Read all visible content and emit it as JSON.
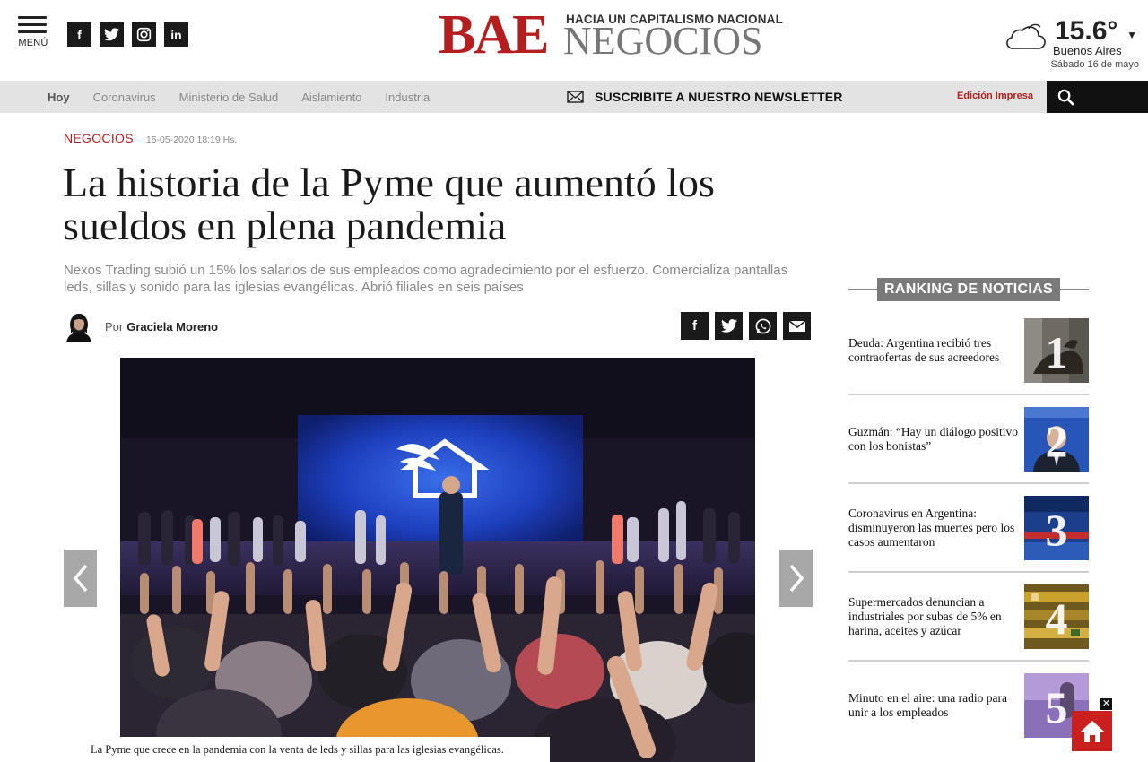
{
  "header": {
    "menu_label": "MENÚ",
    "social": [
      {
        "icon": "facebook-icon",
        "glyph": "f"
      },
      {
        "icon": "twitter-icon",
        "glyph": ""
      },
      {
        "icon": "instagram-icon",
        "glyph": ""
      },
      {
        "icon": "linkedin-icon",
        "glyph": "in"
      }
    ],
    "logo": {
      "main": "BAE",
      "tagline": "HACIA UN CAPITALISMO NACIONAL",
      "sub": "NEGOCIOS"
    },
    "weather": {
      "temp": "15.6°",
      "city": "Buenos Aires",
      "date": "Sábado 16 de mayo"
    }
  },
  "nav": {
    "items": [
      "Hoy",
      "Coronavirus",
      "Ministerio de Salud",
      "Aislamiento",
      "Industria"
    ],
    "newsletter": "SUSCRIBITE A NUESTRO NEWSLETTER",
    "edicion": "Edición Impresa"
  },
  "article": {
    "section": "NEGOCIOS",
    "timestamp": "15-05-2020 18:19 Hs.",
    "title": "La historia de la Pyme que aumentó los sueldos en plena pandemia",
    "subtitle": "Nexos Trading subió un 15% los salarios de sus empleados como agradecimiento por el esfuerzo. Comercializa pantallas leds, sillas y sonido para las iglesias evangélicas. Abrió filiales en seis países",
    "by_label": "Por",
    "author": "Graciela Moreno",
    "caption": "La Pyme que crece en la pandemia con la venta de leds y sillas para las iglesias evangélicas."
  },
  "sidebar": {
    "ranking_title": "RANKING DE NOTICIAS",
    "items": [
      {
        "number": "1",
        "title": "Deuda: Argentina recibió tres contraofertas de sus acreedores"
      },
      {
        "number": "2",
        "title": "Guzmán: “Hay un diálogo positivo con los bonistas”"
      },
      {
        "number": "3",
        "title": "Coronavirus en Argentina: disminuyeron las muertes pero los casos aumentaron"
      },
      {
        "number": "4",
        "title": "Supermercados denuncian a industriales por subas de 5% en harina, aceites y azúcar"
      },
      {
        "number": "5",
        "title": "Minuto en el aire: una radio para unir a los empleados"
      }
    ]
  },
  "floating": {
    "close": "✕"
  },
  "colors": {
    "brand_red": "#b51e1e",
    "nav_bg": "#e3e3e3",
    "text_dark": "#1a1a1a"
  }
}
